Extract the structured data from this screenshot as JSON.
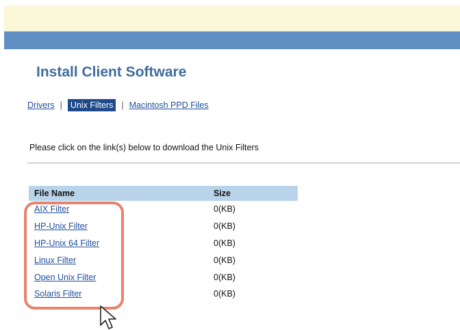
{
  "header": {
    "title": "Install Client Software"
  },
  "tabs": [
    {
      "label": "Drivers",
      "active": false
    },
    {
      "label": "Unix Filters",
      "active": true
    },
    {
      "label": "Macintosh PPD Files",
      "active": false
    }
  ],
  "instruction": "Please click on the link(s) below to download the Unix Filters",
  "table": {
    "columns": [
      "File Name",
      "Size"
    ],
    "rows": [
      {
        "name": "AIX Filter",
        "size": "0(KB)"
      },
      {
        "name": "HP-Unix Filter",
        "size": "0(KB)"
      },
      {
        "name": "HP-Unix 64 Filter",
        "size": "0(KB)"
      },
      {
        "name": "Linux Filter",
        "size": "0(KB)"
      },
      {
        "name": "Open Unix Filter",
        "size": "0(KB)"
      },
      {
        "name": "Solaris Filter",
        "size": "0(KB)"
      }
    ]
  },
  "colors": {
    "banner": "#fbf8d9",
    "top_bar": "#5f8fc3",
    "title": "#3f6c9c",
    "link": "#1f4e9b",
    "active_tab": "#1f4a8a",
    "table_header": "#b9d4ea",
    "highlight": "#e8826c"
  },
  "icons": {
    "cursor": "mouse-pointer-icon"
  }
}
